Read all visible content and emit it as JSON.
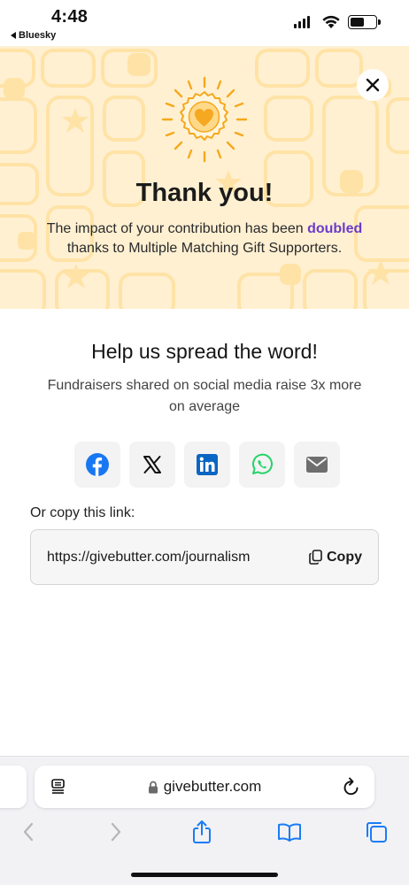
{
  "status_bar": {
    "time": "4:48",
    "back_app": "Bluesky"
  },
  "hero": {
    "title": "Thank you!",
    "message_before": "The impact of your contribution has been ",
    "message_highlight": "doubled",
    "message_after": " thanks to Multiple Matching Gift Supporters.",
    "colors": {
      "background": "#fff0d2",
      "pattern": "#ffe3a6",
      "highlight": "#6b3cc9",
      "heart": "#f6a821"
    }
  },
  "share": {
    "title": "Help us spread the word!",
    "subtitle": "Fundraisers shared on social media raise 3x more on average",
    "buttons": [
      {
        "name": "facebook",
        "icon": "facebook-icon",
        "color": "#1877f2"
      },
      {
        "name": "x",
        "icon": "x-icon",
        "color": "#111111"
      },
      {
        "name": "linkedin",
        "icon": "linkedin-icon",
        "color": "#0a66c2"
      },
      {
        "name": "whatsapp",
        "icon": "whatsapp-icon",
        "color": "#25d366"
      },
      {
        "name": "email",
        "icon": "envelope-icon",
        "color": "#6e6e6e"
      }
    ]
  },
  "copy_link": {
    "label": "Or copy this link:",
    "url": "https://givebutter.com/journalism",
    "button_label": "Copy"
  },
  "browser": {
    "domain": "givebutter.com",
    "icons": [
      "reader-icon",
      "lock-icon",
      "reload-icon",
      "back-icon",
      "forward-icon",
      "share-icon",
      "bookmarks-icon",
      "tabs-icon"
    ],
    "accent": "#1a7cf5"
  }
}
